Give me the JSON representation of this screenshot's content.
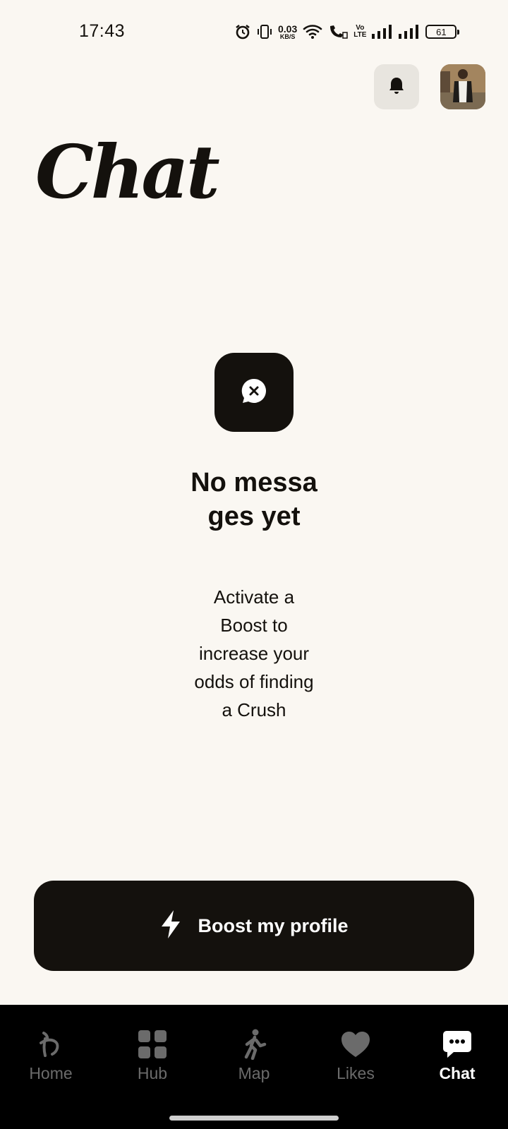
{
  "status_bar": {
    "time": "17:43",
    "net_speed_value": "0.03",
    "net_speed_unit": "KB/S",
    "volte_top": "Vo",
    "volte_bottom": "LTE",
    "battery": "61",
    "icons": [
      "alarm-icon",
      "vibrate-icon",
      "wifi-icon",
      "wifi-calling-icon",
      "signal-icon",
      "signal-icon",
      "battery-icon"
    ]
  },
  "header": {
    "title": "Chat",
    "icons": [
      "bell-icon",
      "avatar"
    ]
  },
  "empty_state": {
    "icon": "chat-off-icon",
    "title": "No messages yet",
    "description": "Activate a Boost to increase your odds of finding a Crush"
  },
  "boost_button": {
    "icon": "lightning-icon",
    "label": "Boost my profile"
  },
  "bottom_nav": {
    "items": [
      {
        "label": "Home",
        "icon": "home-logo-icon",
        "active": false
      },
      {
        "label": "Hub",
        "icon": "grid-icon",
        "active": false
      },
      {
        "label": "Map",
        "icon": "walking-icon",
        "active": false
      },
      {
        "label": "Likes",
        "icon": "heart-icon",
        "active": false
      },
      {
        "label": "Chat",
        "icon": "chat-icon",
        "active": true
      }
    ]
  },
  "colors": {
    "background": "#faf7f2",
    "ink": "#14110d",
    "nav_background": "#000000",
    "nav_inactive": "#6b6b6b",
    "nav_active": "#ffffff"
  }
}
